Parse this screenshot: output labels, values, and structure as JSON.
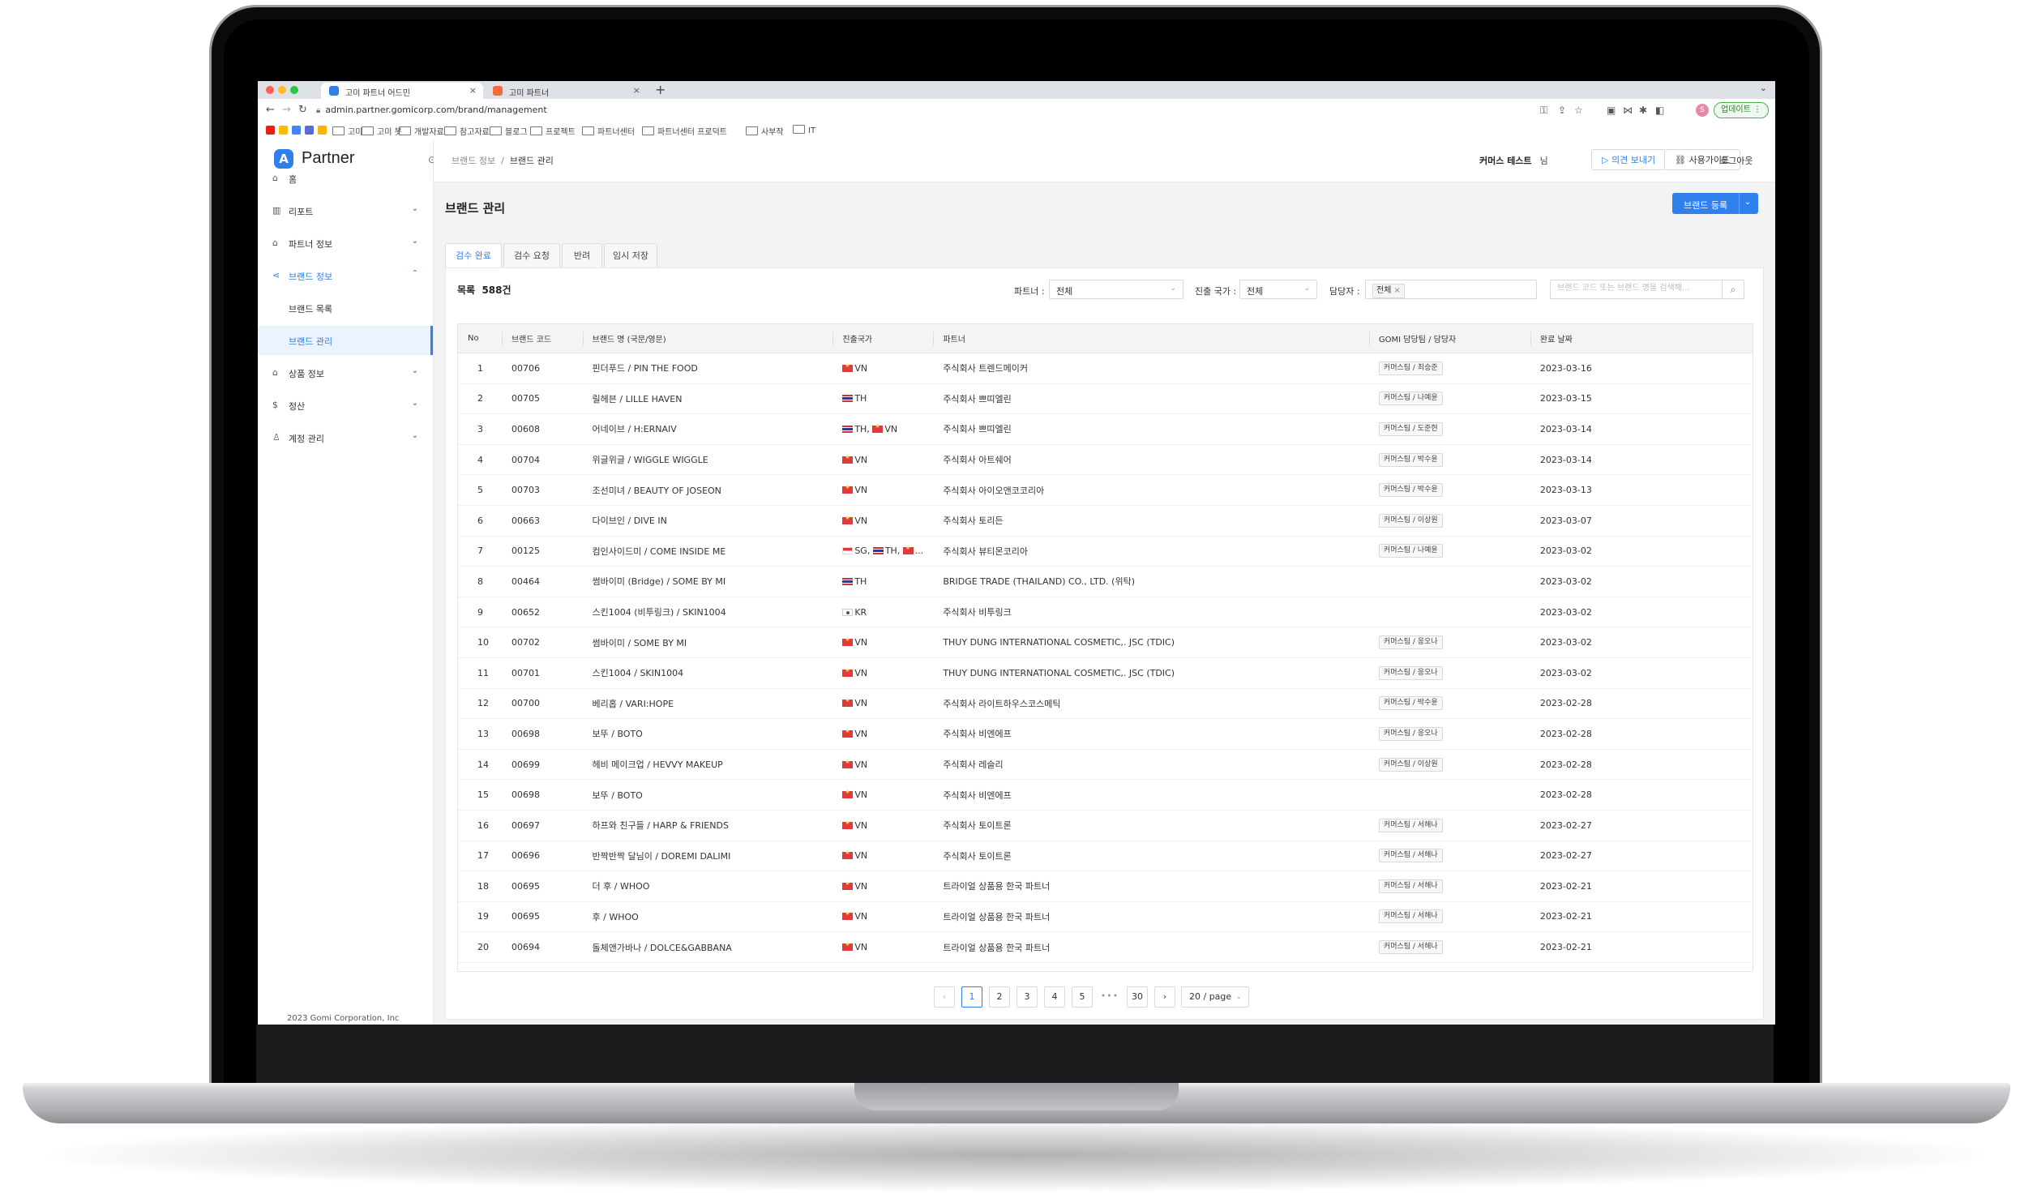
{
  "browser": {
    "tabs": [
      {
        "title": "고미 파트너 어드민",
        "active": true,
        "color": "#2f80ed"
      },
      {
        "title": "고미 파트너",
        "active": false,
        "color": "#f26b3a"
      }
    ],
    "url": "admin.partner.gomicorp.com/brand/management",
    "update_label": "업데이트",
    "avatar_initial": "S",
    "bookmarks": [
      "고미",
      "고미 봇",
      "개발자료",
      "참고자료",
      "블로그",
      "프로젝트",
      "파트너센터",
      "파트너센터 프로덕트",
      "사부작",
      "IT"
    ]
  },
  "app": {
    "logo_letter": "A",
    "logo_text": "Partner",
    "sidebar": {
      "items": [
        {
          "label": "홈",
          "icon": "home-icon"
        },
        {
          "label": "리포트",
          "icon": "chart-icon"
        },
        {
          "label": "파트너 정보",
          "icon": "bank-icon"
        },
        {
          "label": "브랜드 정보",
          "icon": "share-icon"
        },
        {
          "label": "브랜드 목록"
        },
        {
          "label": "브랜드 관리"
        },
        {
          "label": "상품 정보",
          "icon": "shop-icon"
        },
        {
          "label": "정산",
          "icon": "dollar-icon"
        },
        {
          "label": "계정 관리",
          "icon": "users-icon"
        }
      ],
      "footer": "2023 Gomi Corporation, Inc"
    },
    "header": {
      "breadcrumb": [
        "브랜드 정보",
        "브랜드 관리"
      ],
      "user_name": "커머스 테스트",
      "user_suffix": "님",
      "feedback_label": "의견 보내기",
      "guide_label": "사용가이드",
      "logout_label": "로그아웃"
    },
    "page": {
      "title": "브랜드 관리",
      "register_label": "브랜드 등록",
      "tabs": [
        "검수 완료",
        "검수 요청",
        "반려",
        "임시 저장"
      ],
      "list_title": "목록",
      "count": "588건",
      "filters": {
        "partner_label": "파트너 :",
        "partner_value": "전체",
        "country_label": "진출 국가 :",
        "country_value": "전체",
        "manager_label": "담당자 :",
        "manager_tag": "전체",
        "search_placeholder": "브랜드 코드 또는 브랜드 명을 검색해..."
      }
    },
    "table": {
      "headers": [
        "No",
        "브랜드 코드",
        "브랜드 명 (국문/영문)",
        "진출국가",
        "파트너",
        "GOMI 담당팀 / 담당자",
        "완료 날짜"
      ],
      "rows": [
        {
          "no": "1",
          "code": "00706",
          "name": "핀더푸드 / PIN THE FOOD",
          "countries": [
            {
              "flag": "vn",
              "code": "VN"
            }
          ],
          "partner": "주식회사 트렌드메이커",
          "manager": "커머스팀 / 최승준",
          "date": "2023-03-16"
        },
        {
          "no": "2",
          "code": "00705",
          "name": "릴헤븐 / LILLE HAVEN",
          "countries": [
            {
              "flag": "th",
              "code": "TH"
            }
          ],
          "partner": "주식회사 쁘띠엘린",
          "manager": "커머스팀 / 나예윤",
          "date": "2023-03-15"
        },
        {
          "no": "3",
          "code": "00608",
          "name": "어네이브 / H:ERNAIV",
          "countries": [
            {
              "flag": "th",
              "code": "TH, "
            },
            {
              "flag": "vn",
              "code": "VN"
            }
          ],
          "partner": "주식회사 쁘띠엘린",
          "manager": "커머스팀 / 도준현",
          "date": "2023-03-14"
        },
        {
          "no": "4",
          "code": "00704",
          "name": "위글위글 / WIGGLE WIGGLE",
          "countries": [
            {
              "flag": "vn",
              "code": "VN"
            }
          ],
          "partner": "주식회사 아트쉐어",
          "manager": "커머스팀 / 박수윤",
          "date": "2023-03-14"
        },
        {
          "no": "5",
          "code": "00703",
          "name": "조선미녀 / BEAUTY OF JOSEON",
          "countries": [
            {
              "flag": "vn",
              "code": "VN"
            }
          ],
          "partner": "주식회사 아이오앤코코리아",
          "manager": "커머스팀 / 박수윤",
          "date": "2023-03-13"
        },
        {
          "no": "6",
          "code": "00663",
          "name": "다이브인 / DIVE IN",
          "countries": [
            {
              "flag": "vn",
              "code": "VN"
            }
          ],
          "partner": "주식회사 토리든",
          "manager": "커머스팀 / 이상원",
          "date": "2023-03-07"
        },
        {
          "no": "7",
          "code": "00125",
          "name": "컴인사이드미 / COME INSIDE ME",
          "countries": [
            {
              "flag": "sg",
              "code": "SG, "
            },
            {
              "flag": "th",
              "code": "TH, "
            },
            {
              "flag": "vn",
              "code": "..."
            }
          ],
          "partner": "주식회사 뷰티몬코리아",
          "manager": "커머스팀 / 나예윤",
          "date": "2023-03-02"
        },
        {
          "no": "8",
          "code": "00464",
          "name": "썸바이미 (Bridge) / SOME BY MI",
          "countries": [
            {
              "flag": "th",
              "code": "TH"
            }
          ],
          "partner": "BRIDGE TRADE (THAILAND) CO., LTD. (위탁)",
          "manager": "",
          "date": "2023-03-02"
        },
        {
          "no": "9",
          "code": "00652",
          "name": "스킨1004 (비투링크) / SKIN1004",
          "countries": [
            {
              "flag": "kr",
              "code": "KR"
            }
          ],
          "partner": "주식회사 비투링크",
          "manager": "",
          "date": "2023-03-02"
        },
        {
          "no": "10",
          "code": "00702",
          "name": "썸바이미 / SOME BY MI",
          "countries": [
            {
              "flag": "vn",
              "code": "VN"
            }
          ],
          "partner": "THUY DUNG INTERNATIONAL COSMETIC,. JSC (TDIC)",
          "manager": "커머스팀 / 응오나",
          "date": "2023-03-02"
        },
        {
          "no": "11",
          "code": "00701",
          "name": "스킨1004 / SKIN1004",
          "countries": [
            {
              "flag": "vn",
              "code": "VN"
            }
          ],
          "partner": "THUY DUNG INTERNATIONAL COSMETIC,. JSC (TDIC)",
          "manager": "커머스팀 / 응오나",
          "date": "2023-03-02"
        },
        {
          "no": "12",
          "code": "00700",
          "name": "베리홉 / VARI:HOPE",
          "countries": [
            {
              "flag": "vn",
              "code": "VN"
            }
          ],
          "partner": "주식회사 라이트하우스코스메틱",
          "manager": "커머스팀 / 박수윤",
          "date": "2023-02-28"
        },
        {
          "no": "13",
          "code": "00698",
          "name": "보뚜 / BOTO",
          "countries": [
            {
              "flag": "vn",
              "code": "VN"
            }
          ],
          "partner": "주식회사 비엔에프",
          "manager": "커머스팀 / 응오나",
          "date": "2023-02-28"
        },
        {
          "no": "14",
          "code": "00699",
          "name": "헤비 메이크업 / HEVVY MAKEUP",
          "countries": [
            {
              "flag": "vn",
              "code": "VN"
            }
          ],
          "partner": "주식회사 레슬리",
          "manager": "커머스팀 / 이상원",
          "date": "2023-02-28"
        },
        {
          "no": "15",
          "code": "00698",
          "name": "보뚜 / BOTO",
          "countries": [
            {
              "flag": "vn",
              "code": "VN"
            }
          ],
          "partner": "주식회사 비엔에프",
          "manager": "",
          "date": "2023-02-28"
        },
        {
          "no": "16",
          "code": "00697",
          "name": "하프와 친구들 / HARP & FRIENDS",
          "countries": [
            {
              "flag": "vn",
              "code": "VN"
            }
          ],
          "partner": "주식회사 토이트론",
          "manager": "커머스팀 / 서해나",
          "date": "2023-02-27"
        },
        {
          "no": "17",
          "code": "00696",
          "name": "반짝반짝 달님이 / DOREMI DALIMI",
          "countries": [
            {
              "flag": "vn",
              "code": "VN"
            }
          ],
          "partner": "주식회사 토이트론",
          "manager": "커머스팀 / 서해나",
          "date": "2023-02-27"
        },
        {
          "no": "18",
          "code": "00695",
          "name": "더 후 / WHOO",
          "countries": [
            {
              "flag": "vn",
              "code": "VN"
            }
          ],
          "partner": "트라이얼 상품용 한국 파트너",
          "manager": "커머스팀 / 서해나",
          "date": "2023-02-21"
        },
        {
          "no": "19",
          "code": "00695",
          "name": "후 / WHOO",
          "countries": [
            {
              "flag": "vn",
              "code": "VN"
            }
          ],
          "partner": "트라이얼 상품용 한국 파트너",
          "manager": "커머스팀 / 서해나",
          "date": "2023-02-21"
        },
        {
          "no": "20",
          "code": "00694",
          "name": "돌체앤가바나 / DOLCE&GABBANA",
          "countries": [
            {
              "flag": "vn",
              "code": "VN"
            }
          ],
          "partner": "트라이얼 상품용 한국 파트너",
          "manager": "커머스팀 / 서해나",
          "date": "2023-02-21"
        }
      ]
    },
    "pagination": {
      "pages": [
        "1",
        "2",
        "3",
        "4",
        "5"
      ],
      "ellipsis": "•••",
      "last": "30",
      "current": "1",
      "page_size": "20 / page"
    }
  }
}
